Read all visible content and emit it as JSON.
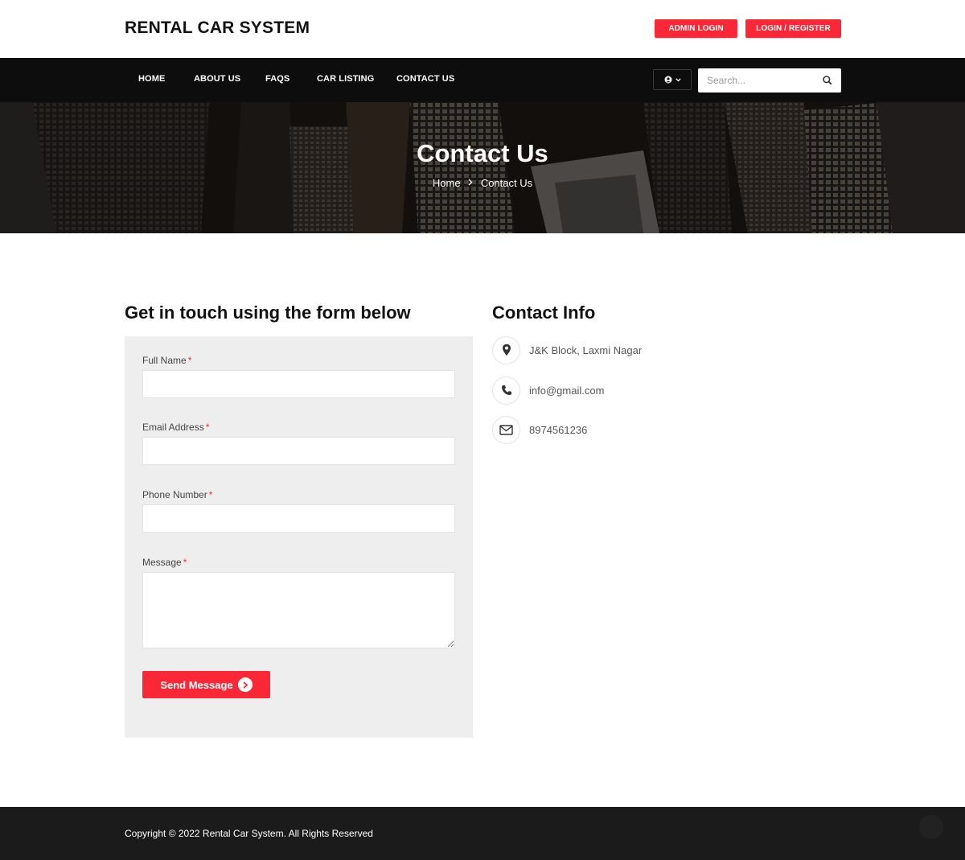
{
  "header": {
    "logo": "RENTAL CAR SYSTEM",
    "admin_login": "ADMIN LOGIN",
    "login_register": "LOGIN / REGISTER"
  },
  "nav": {
    "items": [
      "HOME",
      "ABOUT US",
      "FAQS",
      "CAR LISTING",
      "CONTACT US"
    ],
    "search_placeholder": "Search..."
  },
  "banner": {
    "title": "Contact Us",
    "breadcrumb": [
      "Home",
      "Contact Us"
    ]
  },
  "form": {
    "heading": "Get in touch using the form below",
    "fields": [
      {
        "label": "Full Name",
        "required": "*"
      },
      {
        "label": "Email Address",
        "required": "*"
      },
      {
        "label": "Phone Number",
        "required": "*"
      },
      {
        "label": "Message",
        "required": "*"
      }
    ],
    "submit_label": "Send Message"
  },
  "contact_info": {
    "heading": "Contact Info",
    "items": [
      {
        "icon": "map-marker-icon",
        "text": "J&K Block, Laxmi Nagar"
      },
      {
        "icon": "phone-icon",
        "text": "info@gmail.com"
      },
      {
        "icon": "envelope-icon",
        "text": "8974561236"
      }
    ]
  },
  "footer": {
    "copyright": "Copyright © 2022 Rental Car System. All Rights Reserved"
  },
  "colors": {
    "accent": "#fa2837",
    "nav_bg": "#0d0d0d",
    "footer_bg": "#1b1b1b",
    "panel_bg": "#eeeeee"
  }
}
